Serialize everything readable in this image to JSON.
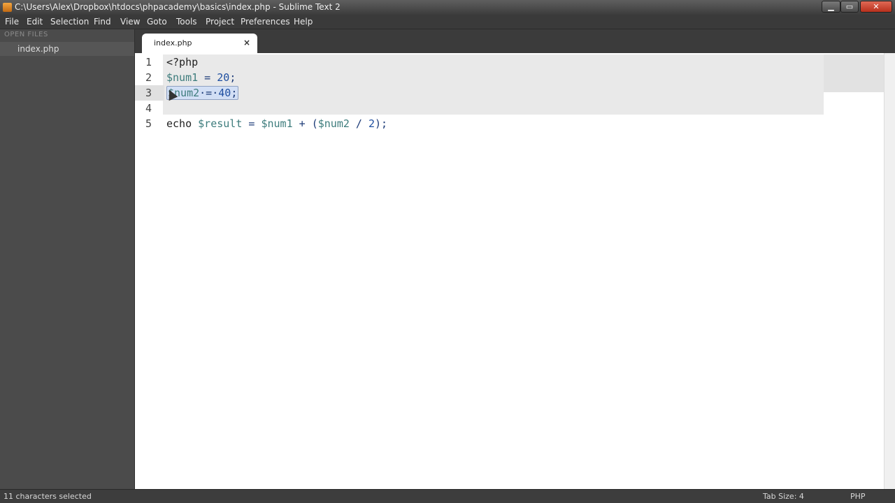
{
  "window": {
    "title": "C:\\Users\\Alex\\Dropbox\\htdocs\\phpacademy\\basics\\index.php - Sublime Text 2"
  },
  "menu": [
    "File",
    "Edit",
    "Selection",
    "Find",
    "View",
    "Goto",
    "Tools",
    "Project",
    "Preferences",
    "Help"
  ],
  "sidebar": {
    "header": "OPEN FILES",
    "files": [
      "index.php"
    ]
  },
  "tabs": [
    {
      "label": "index.php",
      "close": "×"
    }
  ],
  "editor": {
    "line_numbers": [
      "1",
      "2",
      "3",
      "4",
      "5"
    ],
    "lines": [
      {
        "tokens": [
          [
            "kw",
            "<?php"
          ]
        ]
      },
      {
        "tokens": [
          [
            "var",
            "$num1"
          ],
          [
            "op",
            " = "
          ],
          [
            "num",
            "20"
          ],
          [
            "op",
            ";"
          ]
        ]
      },
      {
        "tokens": [
          [
            "var",
            "$num2"
          ],
          [
            "op",
            "·=·"
          ],
          [
            "num",
            "40"
          ],
          [
            "op",
            ";"
          ]
        ],
        "selected": true
      },
      {
        "tokens": []
      },
      {
        "tokens": [
          [
            "kw",
            "echo "
          ],
          [
            "var",
            "$result"
          ],
          [
            "op",
            " = "
          ],
          [
            "var",
            "$num1"
          ],
          [
            "op",
            " + ("
          ],
          [
            "var",
            "$num2"
          ],
          [
            "op",
            " / "
          ],
          [
            "num",
            "2"
          ],
          [
            "op",
            ");"
          ]
        ]
      }
    ]
  },
  "status": {
    "left": "11 characters selected",
    "tab_size": "Tab Size: 4",
    "syntax": "PHP"
  },
  "colors": {
    "variable": "#3d7c7c",
    "number": "#1f4fa0",
    "selection": "#d2dff5"
  }
}
